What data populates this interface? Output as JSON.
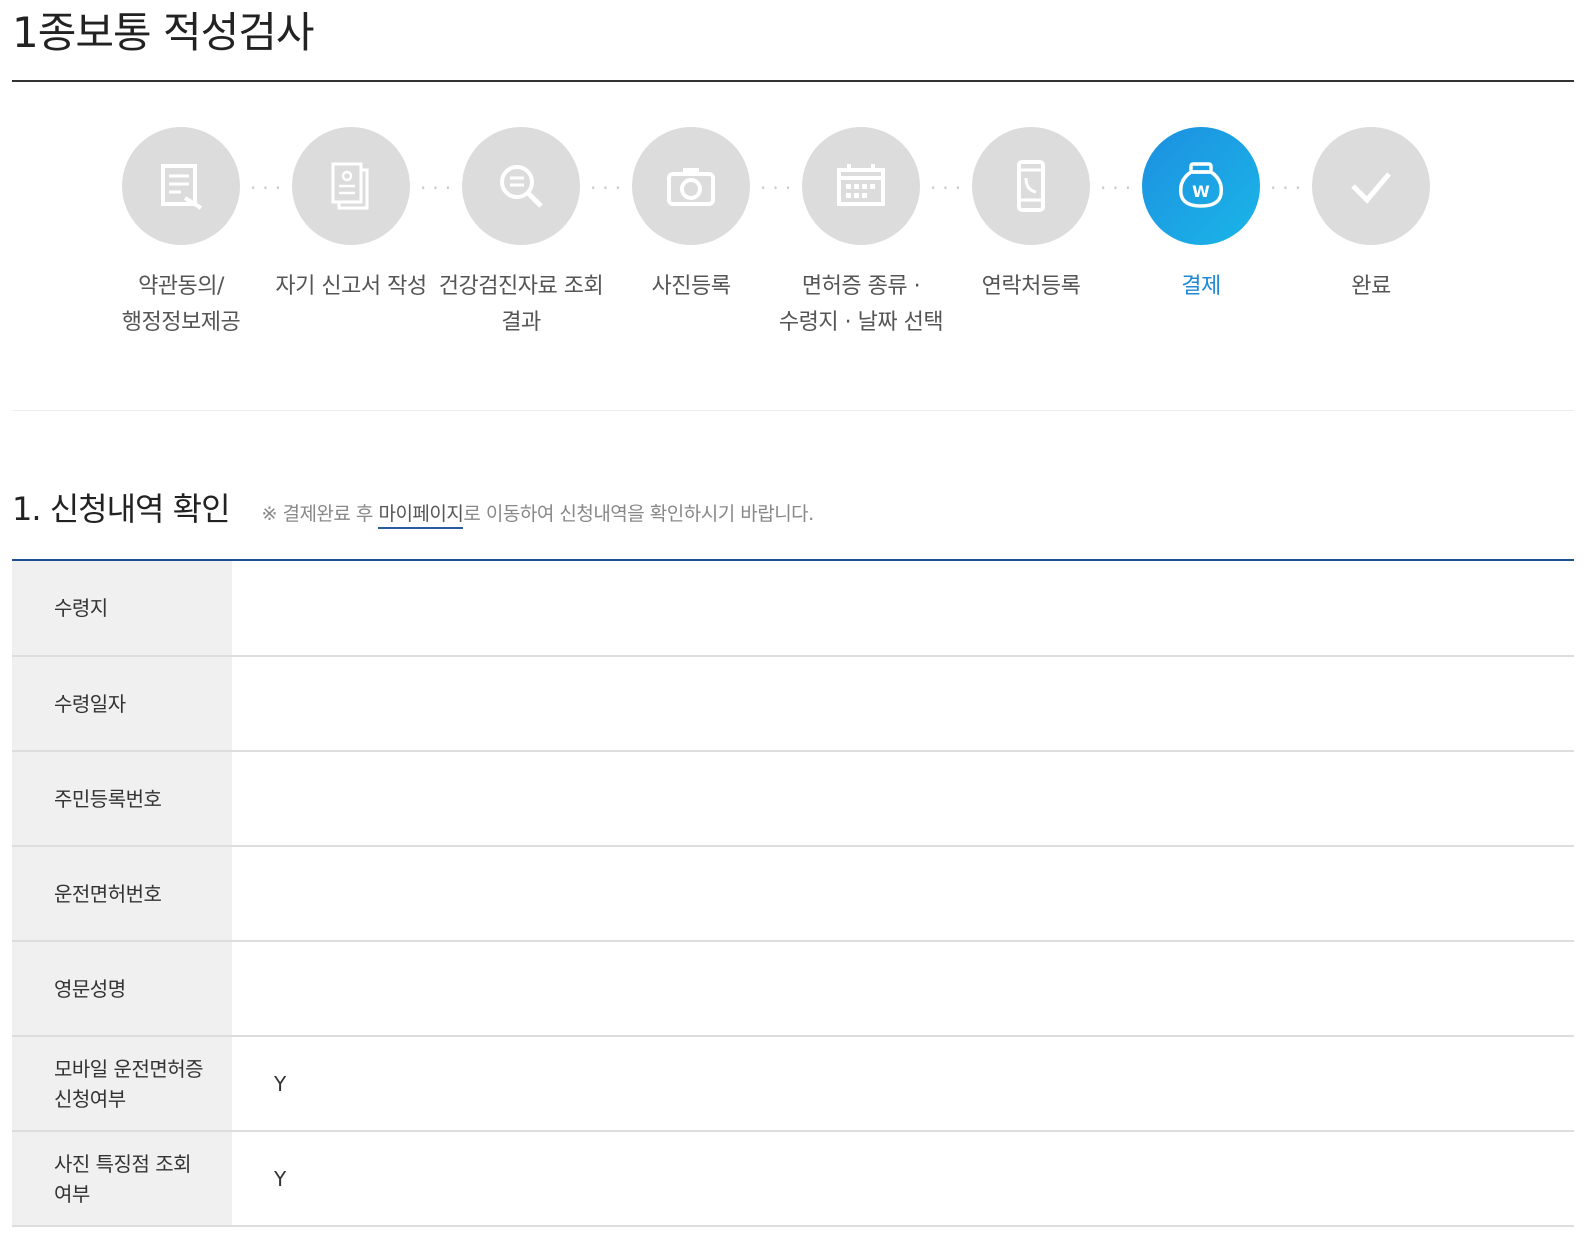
{
  "page": {
    "title": "1종보통 적성검사"
  },
  "steps": [
    {
      "label": "약관동의/\n행정정보제공",
      "icon": "document-edit-icon",
      "active": false
    },
    {
      "label": "자기 신고서 작성",
      "icon": "self-report-icon",
      "active": false
    },
    {
      "label": "건강검진자료 조회\n결과",
      "icon": "magnifier-icon",
      "active": false
    },
    {
      "label": "사진등록",
      "icon": "camera-icon",
      "active": false
    },
    {
      "label": "면허증 종류 ·\n수령지 · 날짜 선택",
      "icon": "calendar-icon",
      "active": false
    },
    {
      "label": "연락처등록",
      "icon": "phone-icon",
      "active": false
    },
    {
      "label": "결제",
      "icon": "won-pouch-icon",
      "active": true
    },
    {
      "label": "완료",
      "icon": "check-icon",
      "active": false
    }
  ],
  "section": {
    "title": "1. 신청내역 확인",
    "notice_prefix": "※ 결제완료 후 ",
    "notice_link": "마이페이지",
    "notice_suffix": "로 이동하여 신청내역을 확인하시기 바랍니다."
  },
  "table": {
    "rows": [
      {
        "label": "수령지",
        "value": ""
      },
      {
        "label": "수령일자",
        "value": ""
      },
      {
        "label": "주민등록번호",
        "value": ""
      },
      {
        "label": "운전면허번호",
        "value": ""
      },
      {
        "label": "영문성명",
        "value": ""
      },
      {
        "label": "모바일 운전면허증\n신청여부",
        "value": "Y"
      },
      {
        "label": "사진 특징점 조회\n여부",
        "value": "Y"
      }
    ]
  },
  "colors": {
    "active_step": "#1d8fe0",
    "inactive_step": "#dcdcdc",
    "table_top_rule": "#1e4f8e"
  }
}
